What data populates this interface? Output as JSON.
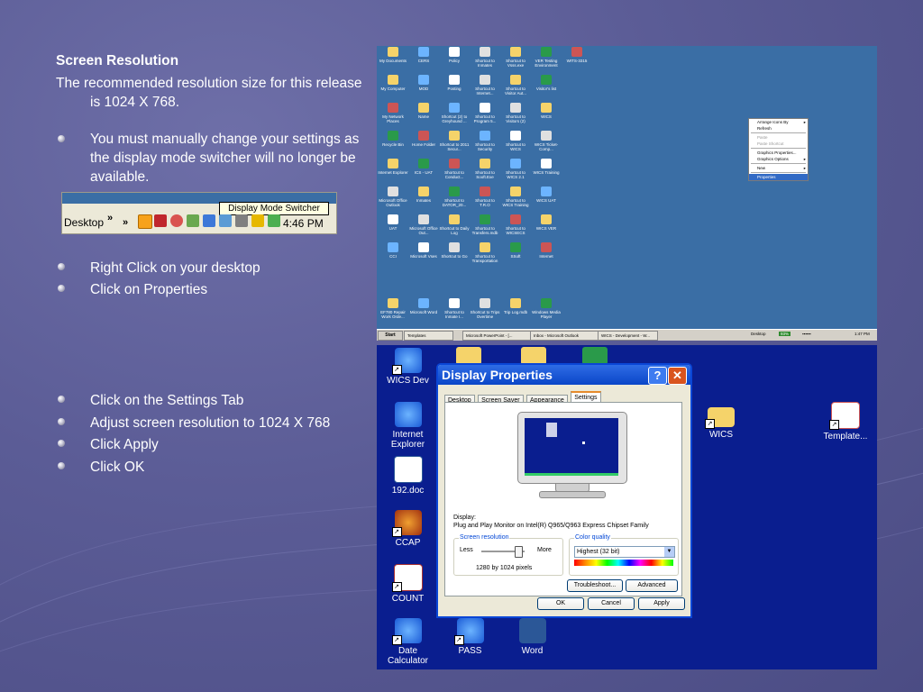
{
  "slide": {
    "title": "Screen Resolution",
    "intro": "The recommended resolution size for this release is 1024 X 768.",
    "bullets_group1": [
      "You must manually change your settings as the display mode switcher will no longer be available."
    ],
    "bullets_group2": [
      "Right Click on your desktop",
      "Click on Properties"
    ],
    "bullets_group3": [
      "Click on the Settings Tab",
      "Adjust screen resolution to 1024 X 768",
      "Click Apply",
      "Click OK"
    ]
  },
  "taskbar_snippet": {
    "tooltip": "Display Mode Switcher",
    "desktop_label": "Desktop",
    "chevron": "»",
    "time": "4:46 PM"
  },
  "desktop_shot": {
    "icons": [
      "My Documents",
      "CERS",
      "Policy",
      "Shortcut to Inmates",
      "Shortcut to Vsss.exe",
      "VER Testing Environment",
      "WITS-3315",
      "My Computer",
      "MOD",
      "Posting",
      "Shortcut to Internet...",
      "Shortcut to Visitor Aut...",
      "Visitor's list",
      "My Network Places",
      "Name",
      "Shortcut (2) to Greyhound ...",
      "Shortcut to Program 5...",
      "Shortcut to Visitors (2)",
      "WICS",
      "Recycle Bin",
      "Home Folder",
      "Shortcut to 2011 Secur...",
      "Shortcut to Security",
      "Shortcut to WICS",
      "WICS Ticket-Comp...",
      "Internet Explorer",
      "ICS - UAT",
      "Shortcut to Conduct...",
      "Shortcut to Sooft.Exe",
      "Shortcut to WICS 2.1",
      "WICS Training",
      "Microsoft Office Outlook",
      "Inmates",
      "Shortcut to DATOR_20...",
      "Shortcut to T.R.O",
      "Shortcut to WICS Training",
      "WICS UAT",
      "UAT",
      "Microsoft Office Out...",
      "Shortcut to Daily Log",
      "Shortcut to Transfers.mdb",
      "Shortcut to WICSECS",
      "WICS VER",
      "CCI",
      "Microsoft Vses",
      "Shortcut to Go",
      "Shortcut to Transportation",
      "SSoft",
      "Internet",
      "EF780 Repair Work Orde...",
      "Microsoft Word",
      "Shortcut to Inmate I...",
      "Shortcut to Trips Overtime",
      "Trip Log.mdb",
      "Windows Media Player"
    ],
    "context_menu": [
      "Arrange Icons By",
      "Refresh",
      "Paste",
      "Paste Shortcut",
      "Graphics Properties...",
      "Graphics Options",
      "New",
      "Properties"
    ],
    "taskbar": {
      "start": "Start",
      "buttons": [
        "Templates",
        "Microsoft PowerPoint - [...",
        "Inbox - Microsoft Outlook",
        "WICS - Development - W..."
      ],
      "desktop": "Desktop",
      "percent": "93%",
      "time": "1:47 PM"
    }
  },
  "settings_shot": {
    "desktop_icons": {
      "left": [
        "WICS Dev",
        "Internet Explorer",
        "192.doc",
        "CCAP",
        "COUNT",
        "Date Calculator"
      ],
      "bottom": [
        "PASS",
        "Word"
      ],
      "right": [
        "WICS",
        "Template..."
      ]
    },
    "dialog": {
      "title": "Display Properties",
      "help": "?",
      "close": "✕",
      "tabs": [
        "Desktop",
        "Screen Saver",
        "Appearance",
        "Settings"
      ],
      "active_tab": "Settings",
      "display_label": "Display:",
      "display_value": "Plug and Play Monitor on Intel(R)  Q965/Q963 Express Chipset Family",
      "screen_resolution": {
        "legend": "Screen resolution",
        "less": "Less",
        "more": "More",
        "value": "1280 by 1024 pixels",
        "slider_fraction": 0.85
      },
      "color_quality": {
        "legend": "Color quality",
        "value": "Highest (32 bit)"
      },
      "troubleshoot": "Troubleshoot...",
      "advanced": "Advanced",
      "ok": "OK",
      "cancel": "Cancel",
      "apply": "Apply"
    }
  },
  "colors": {
    "slide_bg": "#5b5c96",
    "xp_desktop": "#3a6ea5",
    "classic_desktop": "#0a1e8f",
    "dialog_title": "#0a46c8"
  }
}
